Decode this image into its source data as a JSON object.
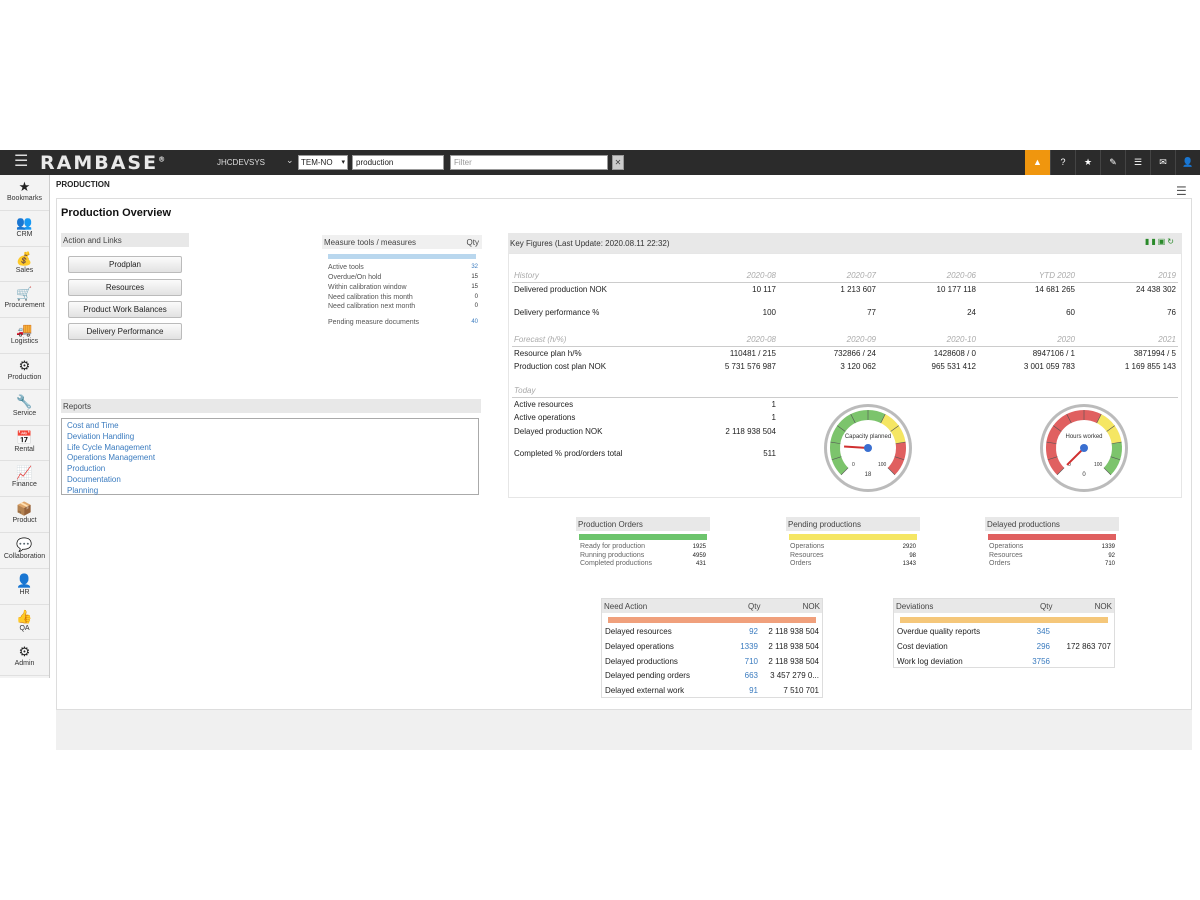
{
  "topbar": {
    "logo": "RAMBASE",
    "logo_mark": "®",
    "company": "JHCDEVSYS",
    "language": "TEM-NO",
    "search_value": "production",
    "filter_placeholder": "Filter",
    "accent_color": "#f0960e"
  },
  "sidebar": {
    "items": [
      {
        "label": "Bookmarks",
        "icon": "star-icon",
        "glyph": "★"
      },
      {
        "label": "CRM",
        "icon": "people-icon",
        "glyph": "👥"
      },
      {
        "label": "Sales",
        "icon": "money-bag-icon",
        "glyph": "💰"
      },
      {
        "label": "Procurement",
        "icon": "cart-icon",
        "glyph": "🛒"
      },
      {
        "label": "Logistics",
        "icon": "truck-icon",
        "glyph": "🚚"
      },
      {
        "label": "Production",
        "icon": "gears-icon",
        "glyph": "⚙"
      },
      {
        "label": "Service",
        "icon": "wrench-icon",
        "glyph": "🔧"
      },
      {
        "label": "Rental",
        "icon": "calendar-icon",
        "glyph": "📅"
      },
      {
        "label": "Finance",
        "icon": "chart-line-icon",
        "glyph": "📈"
      },
      {
        "label": "Product",
        "icon": "box-icon",
        "glyph": "📦"
      },
      {
        "label": "Collaboration",
        "icon": "chat-icon",
        "glyph": "💬"
      },
      {
        "label": "HR",
        "icon": "person-icon",
        "glyph": "👤"
      },
      {
        "label": "QA",
        "icon": "thumbs-up-icon",
        "glyph": "👍"
      },
      {
        "label": "Admin",
        "icon": "cog-icon",
        "glyph": "⚙"
      }
    ]
  },
  "page": {
    "header": "PRODUCTION",
    "title": "Production Overview"
  },
  "actions": {
    "heading": "Action and Links",
    "buttons": [
      "Prodplan",
      "Resources",
      "Product Work Balances",
      "Delivery Performance"
    ]
  },
  "measure": {
    "heading": "Measure tools / measures",
    "qty_heading": "Qty",
    "rows": [
      {
        "label": "Active tools",
        "value": "32"
      },
      {
        "label": "Overdue/On hold",
        "value": "15"
      },
      {
        "label": "Within calibration window",
        "value": "15"
      },
      {
        "label": "Need calibration this month",
        "value": "0"
      },
      {
        "label": "Need calibration next month",
        "value": "0"
      }
    ],
    "pending": {
      "label": "Pending measure documents",
      "value": "40"
    }
  },
  "reports": {
    "heading": "Reports",
    "links": [
      "Cost and Time",
      "Deviation Handling",
      "Life Cycle Management",
      "Operations Management",
      "Production",
      "Documentation",
      "Planning"
    ]
  },
  "key_figures": {
    "heading": "Key Figures (Last Update: 2020.08.11 22:32)",
    "history": {
      "label": "History",
      "columns": [
        "2020-08",
        "2020-07",
        "2020-06",
        "YTD 2020",
        "2019"
      ],
      "rows": [
        {
          "label": "Delivered production NOK",
          "values": [
            "10 117",
            "1 213 607",
            "10 177 118",
            "14 681 265",
            "24 438 302"
          ]
        },
        {
          "label": "Delivery performance %",
          "values": [
            "100",
            "77",
            "24",
            "60",
            "76"
          ]
        }
      ]
    },
    "forecast": {
      "label": "Forecast (h/%)",
      "columns": [
        "2020-08",
        "2020-09",
        "2020-10",
        "2020",
        "2021"
      ],
      "rows": [
        {
          "label": "Resource plan h/%",
          "values": [
            "110481 / 215",
            "732866 / 24",
            "1428608 / 0",
            "8947106 / 1",
            "3871994 / 5"
          ]
        },
        {
          "label": "Production cost plan NOK",
          "values": [
            "5 731 576 987",
            "3 120 062",
            "965 531 412",
            "3 001 059 783",
            "1 169 855 143"
          ]
        }
      ]
    },
    "today": {
      "label": "Today",
      "rows": [
        {
          "label": "Active resources",
          "value": "1"
        },
        {
          "label": "Active operations",
          "value": "1"
        },
        {
          "label": "Delayed production NOK",
          "value": "2 118 938 504"
        },
        {
          "label": "Completed % prod/orders total",
          "value": "511"
        }
      ]
    },
    "gauges": [
      {
        "label": "Capacity planned",
        "min": "0",
        "max": "100",
        "readout": "18",
        "value": 18,
        "style": "green-low"
      },
      {
        "label": "Hours worked",
        "min": "0",
        "max": "100",
        "readout": "0",
        "value": 0,
        "style": "red-low"
      }
    ]
  },
  "summaries": [
    {
      "title": "Production Orders",
      "color": "#6cc46c",
      "rows": [
        {
          "label": "Ready for production",
          "value": "1925"
        },
        {
          "label": "Running productions",
          "value": "4959"
        },
        {
          "label": "Completed productions",
          "value": "431"
        }
      ]
    },
    {
      "title": "Pending productions",
      "color": "#f5e663",
      "rows": [
        {
          "label": "Operations",
          "value": "2920"
        },
        {
          "label": "Resources",
          "value": "98"
        },
        {
          "label": "Orders",
          "value": "1343"
        }
      ]
    },
    {
      "title": "Delayed productions",
      "color": "#e06060",
      "rows": [
        {
          "label": "Operations",
          "value": "1339"
        },
        {
          "label": "Resources",
          "value": "92"
        },
        {
          "label": "Orders",
          "value": "710"
        }
      ]
    }
  ],
  "need_action": {
    "title": "Need Action",
    "qty": "Qty",
    "nok": "NOK",
    "color": "#f0a07c",
    "rows": [
      {
        "label": "Delayed resources",
        "qty": "92",
        "nok": "2 118 938 504"
      },
      {
        "label": "Delayed operations",
        "qty": "1339",
        "nok": "2 118 938 504"
      },
      {
        "label": "Delayed productions",
        "qty": "710",
        "nok": "2 118 938 504"
      },
      {
        "label": "Delayed pending orders",
        "qty": "663",
        "nok": "3 457 279 0..."
      },
      {
        "label": "Delayed external work",
        "qty": "91",
        "nok": "7 510 701"
      }
    ]
  },
  "deviations": {
    "title": "Deviations",
    "qty": "Qty",
    "nok": "NOK",
    "color": "#f5c77a",
    "rows": [
      {
        "label": "Overdue quality reports",
        "qty": "345",
        "nok": ""
      },
      {
        "label": "Cost deviation",
        "qty": "296",
        "nok": "172 863 707"
      },
      {
        "label": "Work log deviation",
        "qty": "3756",
        "nok": ""
      }
    ]
  }
}
